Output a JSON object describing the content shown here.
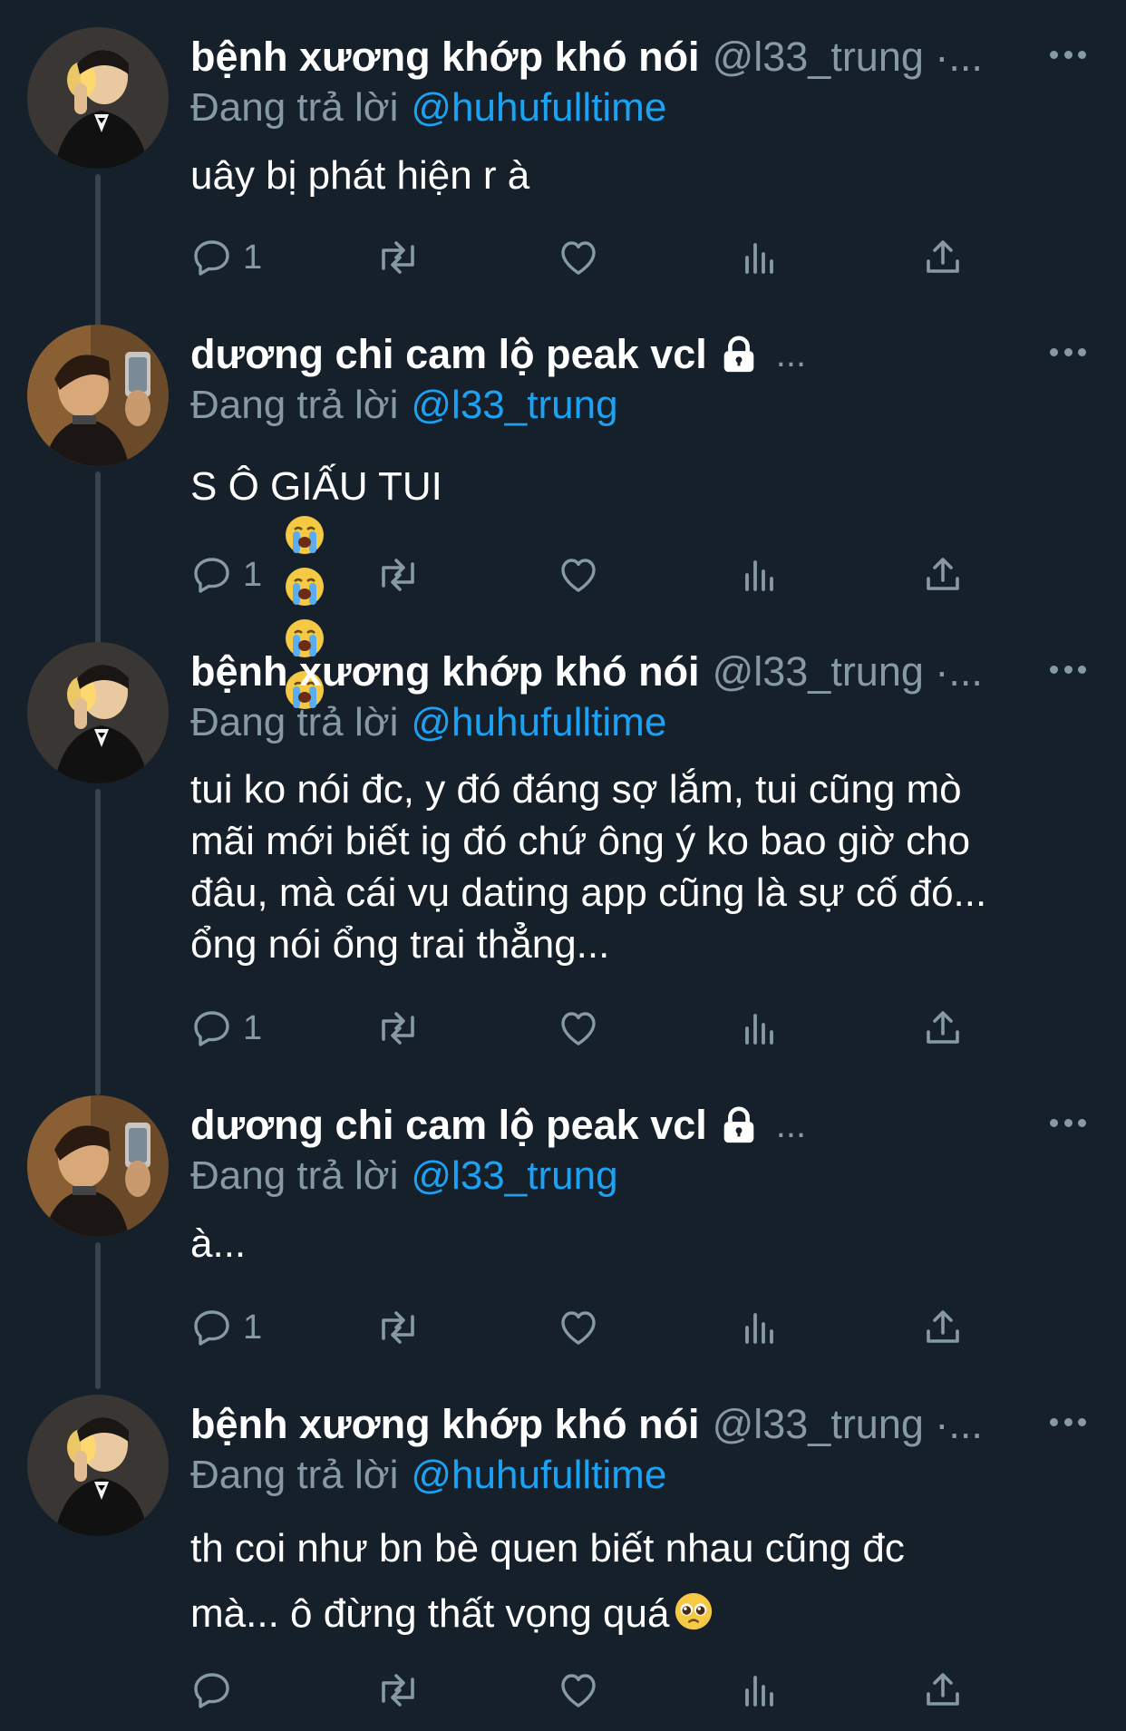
{
  "tweets": [
    {
      "name": "bệnh xương khớp khó nói",
      "handle": "@l33_trung ·...",
      "locked": false,
      "suffix": "",
      "reply_prefix": "Đang trả lời",
      "reply_target": "@huhufulltime",
      "text": "uây bị phát hiện r à",
      "emoji": "",
      "reply_count": "1",
      "avatar": "avatar-person-a"
    },
    {
      "name": "dương chi cam lộ peak vcl",
      "handle": "",
      "locked": true,
      "suffix": "...",
      "reply_prefix": "Đang trả lời",
      "reply_target": "@l33_trung",
      "text": "S Ô GIẤU TUI ",
      "emoji": "loudly-crying-face x4",
      "reply_count": "1",
      "avatar": "avatar-person-b"
    },
    {
      "name": "bệnh xương khớp khó nói",
      "handle": "@l33_trung ·...",
      "locked": false,
      "suffix": "",
      "reply_prefix": "Đang trả lời",
      "reply_target": "@huhufulltime",
      "text": "tui ko nói đc, y đó đáng sợ lắm, tui cũng mò\nmãi mới biết ig đó chứ ông ý ko bao giờ cho\nđâu, mà cái vụ dating app cũng là sự cố đó...\nổng nói ổng trai thẳng...",
      "emoji": "",
      "reply_count": "1",
      "avatar": "avatar-person-a"
    },
    {
      "name": "dương chi cam lộ peak vcl",
      "handle": "",
      "locked": true,
      "suffix": "...",
      "reply_prefix": "Đang trả lời",
      "reply_target": "@l33_trung",
      "text": "à...",
      "emoji": "",
      "reply_count": "1",
      "avatar": "avatar-person-b"
    },
    {
      "name": "bệnh xương khớp khó nói",
      "handle": "@l33_trung ·...",
      "locked": false,
      "suffix": "",
      "reply_prefix": "Đang trả lời",
      "reply_target": "@huhufulltime",
      "text": "th coi như bn bè quen biết nhau cũng đc\nmà... ô đừng thất vọng quá",
      "emoji": "pleading-face",
      "reply_count": "",
      "avatar": "avatar-person-a"
    }
  ],
  "icons": {
    "reply": "reply-icon",
    "retweet": "retweet-icon",
    "like": "heart-icon",
    "analytics": "analytics-icon",
    "share": "share-icon",
    "more": "more-icon",
    "lock": "lock-icon"
  },
  "colors": {
    "background": "#15202b",
    "text": "#ffffff",
    "secondary": "#8899a6",
    "link": "#1da1f2",
    "thread_line": "#38444d"
  }
}
